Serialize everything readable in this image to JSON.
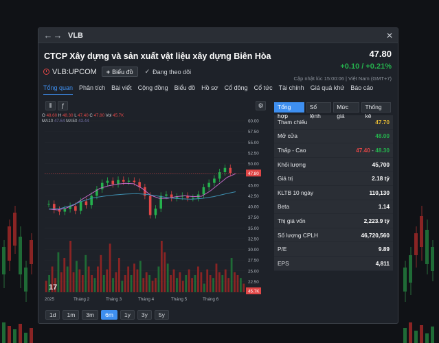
{
  "window": {
    "title": "VLB",
    "back_icon": "arrow-left-icon",
    "forward_icon": "arrow-right-icon",
    "close_icon": "close-icon"
  },
  "header": {
    "company_name": "CTCP Xây dựng và sản xuất vật liệu xây dựng Biên Hòa",
    "ticker": "VLB:UPCOM",
    "chart_button": "Biểu đồ",
    "follow_label": "Đang theo dõi",
    "price": "47.80",
    "change": "+0.10 / +0.21%",
    "updated": "Cập nhật lúc  15:00:06 | Việt Nam (GMT+7)"
  },
  "tabs": [
    {
      "label": "Tổng quan",
      "active": true
    },
    {
      "label": "Phân tích"
    },
    {
      "label": "Bài viết"
    },
    {
      "label": "Cộng đồng"
    },
    {
      "label": "Biểu đồ"
    },
    {
      "label": "Hồ sơ"
    },
    {
      "label": "Cổ đông"
    },
    {
      "label": "Cổ tức"
    },
    {
      "label": "Tài chính"
    },
    {
      "label": "Giá quá khứ"
    },
    {
      "label": "Báo cáo"
    }
  ],
  "chart_legend": {
    "o_label": "O",
    "o": "48.60",
    "h_label": "H",
    "h": "48.30",
    "l_label": "L",
    "l": "47.40",
    "c_label": "C",
    "c": "47.80",
    "vol_label": "Vol",
    "vol": "45.7K",
    "ma10_label": "MA10",
    "ma10": "47.64",
    "ma50_label": "MA50",
    "ma50": "43.44"
  },
  "range_buttons": [
    {
      "label": "1d"
    },
    {
      "label": "1m"
    },
    {
      "label": "3m"
    },
    {
      "label": "6m",
      "active": true
    },
    {
      "label": "1y"
    },
    {
      "label": "3y"
    },
    {
      "label": "5y"
    }
  ],
  "side_tabs": [
    {
      "label": "Tổng hợp",
      "active": true
    },
    {
      "label": "Sổ lệnh"
    },
    {
      "label": "Mức giá"
    },
    {
      "label": "Thống kê"
    }
  ],
  "stats": [
    {
      "label": "Tham chiếu",
      "value": "47.70",
      "color": "yellow"
    },
    {
      "label": "Mở cửa",
      "value": "48.00",
      "color": "green"
    },
    {
      "label": "Thấp - Cao",
      "low": "47.40",
      "sep": " - ",
      "high": "48.30"
    },
    {
      "label": "Khối lượng",
      "value": "45,700"
    },
    {
      "label": "Giá trị",
      "value": "2.18 tỷ"
    },
    {
      "label": "KLTB 10 ngày",
      "value": "110,130"
    },
    {
      "label": "Beta",
      "value": "1.14"
    },
    {
      "label": "Thị giá vốn",
      "value": "2,223.9 tỷ"
    },
    {
      "label": "Số lượng CPLH",
      "value": "46,720,560"
    },
    {
      "label": "P/E",
      "value": "9.89"
    },
    {
      "label": "EPS",
      "value": "4,811"
    }
  ],
  "chart_data": {
    "type": "line",
    "x_ticks": [
      "2025",
      "Tháng 2",
      "Tháng 3",
      "Tháng 4",
      "Tháng 5",
      "Tháng 6"
    ],
    "y_ticks": [
      "60.00",
      "57.50",
      "55.00",
      "52.50",
      "50.00",
      "47.50",
      "45.00",
      "42.50",
      "40.00",
      "37.50",
      "35.00",
      "32.50",
      "30.00",
      "27.50",
      "25.00",
      "22.50",
      "20.00"
    ],
    "ylim": [
      20,
      60
    ],
    "current_price_label": "47.80",
    "current_volume_label": "45.7K",
    "series": [
      {
        "name": "Giá",
        "values": [
          40.6,
          39.2,
          38.8,
          39.4,
          40.1,
          39.0,
          41.2,
          40.3,
          42.5,
          44.0,
          45.5,
          46.0,
          45.2,
          46.2,
          45.8,
          46.0,
          45.7,
          44.5,
          42.5,
          38.0,
          39.5,
          42.5,
          42.8,
          42.0,
          42.3,
          42.5,
          42.0,
          42.0,
          42.8,
          44.5,
          45.5,
          46.5,
          48.0,
          49.0,
          47.8
        ]
      },
      {
        "name": "MA10",
        "values": [
          39.4,
          39.2,
          39.6,
          40.4,
          41.8,
          43.0,
          44.2,
          44.8,
          45.2,
          45.4,
          45.3,
          44.2,
          42.6,
          41.9,
          41.9,
          42.3,
          42.5,
          42.3,
          42.4,
          43.6,
          45.2,
          46.8,
          47.64
        ]
      },
      {
        "name": "MA50",
        "values": [
          39.4,
          39.5,
          40.2,
          41.2,
          42.0,
          42.4,
          42.7,
          42.9,
          43.0,
          42.8,
          42.4,
          42.0,
          41.8,
          41.7,
          41.9,
          42.3,
          42.9,
          43.44
        ]
      }
    ],
    "volume": [
      4,
      6,
      9,
      5,
      14,
      7,
      12,
      9,
      18,
      7,
      11,
      8,
      6,
      13,
      9,
      6,
      5,
      9,
      13,
      6,
      8,
      17,
      5,
      7,
      12,
      4,
      6,
      9,
      6,
      10,
      8,
      11,
      5,
      7,
      6,
      4,
      5,
      9,
      18,
      14,
      10,
      6,
      8,
      5,
      7,
      4,
      6,
      8,
      5,
      6,
      9,
      7,
      3,
      8,
      6,
      5,
      10,
      7,
      6,
      8,
      5,
      12,
      7,
      6,
      5,
      3
    ]
  }
}
